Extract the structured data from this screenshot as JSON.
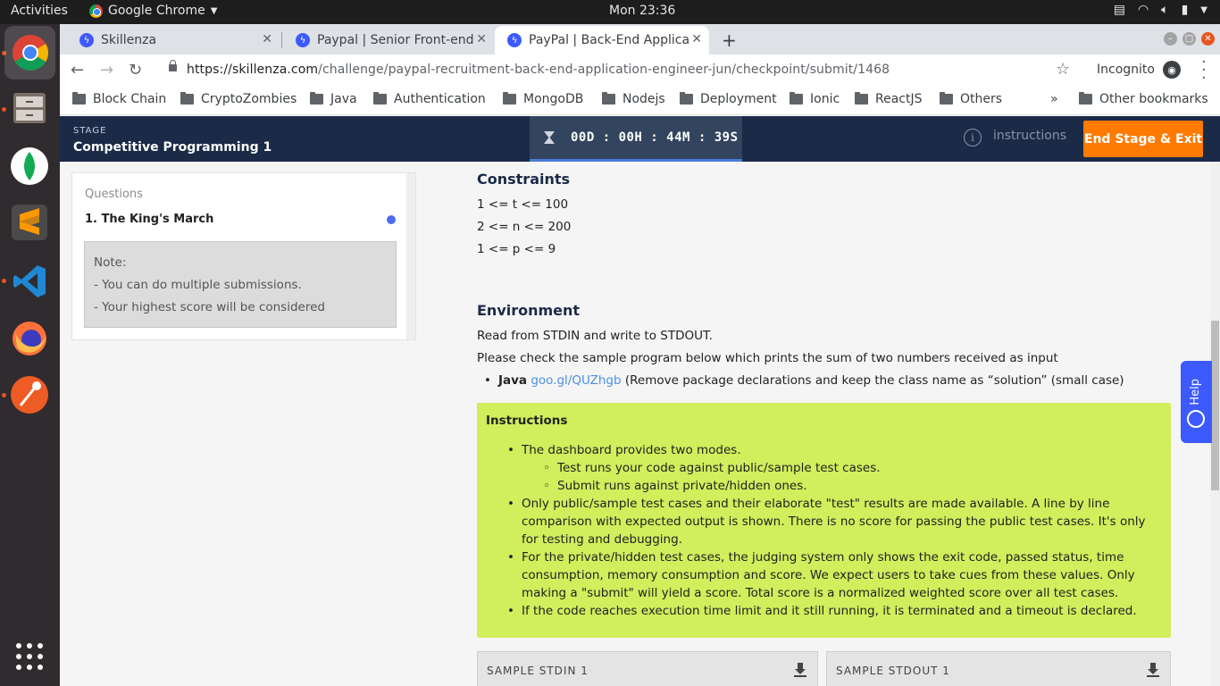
{
  "os": {
    "activities": "Activities",
    "app_name": "Google Chrome",
    "clock": "Mon 23:36"
  },
  "tabs": [
    {
      "title": "Skillenza"
    },
    {
      "title": "Paypal | Senior Front-end"
    },
    {
      "title": "PayPal | Back-End Applica"
    }
  ],
  "toolbar": {
    "url_domain": "https://skillenza.com",
    "url_path": "/challenge/paypal-recruitment-back-end-application-engineer-jun/checkpoint/submit/1468",
    "incognito": "Incognito"
  },
  "bookmarks": [
    "Block Chain",
    "CryptoZombies",
    "Java",
    "Authentication",
    "MongoDB",
    "Nodejs",
    "Deployment",
    "Ionic",
    "ReactJS",
    "Others"
  ],
  "other_bookmarks": "Other bookmarks",
  "stage": {
    "label": "STAGE",
    "name": "Competitive Programming 1",
    "timer": "00D : 00H : 44M : 39S",
    "instructions": "instructions",
    "end_button": "End Stage & Exit"
  },
  "questions": {
    "heading": "Questions",
    "items": [
      "1. The King's March"
    ],
    "note_title": "Note:",
    "note_lines": [
      "- You can do multiple submissions.",
      "- Your highest score will be considered"
    ]
  },
  "content": {
    "constraints_title": "Constraints",
    "constraints": [
      "1 <= t <= 100",
      "2 <= n <= 200",
      "1 <= p <= 9"
    ],
    "environment_title": "Environment",
    "env_line1": "Read from STDIN and write to STDOUT.",
    "env_line2": "Please check the sample program below which prints the sum of two numbers received as input",
    "java_label": "Java",
    "java_link": "goo.gl/QUZhgb",
    "java_note": "(Remove package declarations and keep the class name as “solution” (small case)"
  },
  "instructions": {
    "title": "Instructions",
    "item1": "The dashboard provides two modes.",
    "sub1": "Test runs your code against public/sample test cases.",
    "sub2": "Submit runs against private/hidden ones.",
    "item2": "Only public/sample test cases and their elaborate \"test\" results are made available. A line by line comparison with expected output is shown. There is no score for passing the public test cases. It's only for testing and debugging.",
    "item3": "For the private/hidden test cases, the judging system only shows the exit code, passed status, time consumption, memory consumption and score. We expect users to take cues from these values. Only making a \"submit\" will yield a score. Total score is a normalized weighted score over all test cases.",
    "item4": "If the code reaches execution time limit and it still running, it is terminated and a timeout is declared."
  },
  "samples": {
    "stdin": "SAMPLE STDIN 1",
    "stdout": "SAMPLE STDOUT 1"
  },
  "help": "Help",
  "colors": {
    "header_bg": "#1b2a47",
    "accent_orange": "#ff7a00",
    "instructions_bg": "#d1ee5c",
    "help_blue": "#3d5afe"
  }
}
